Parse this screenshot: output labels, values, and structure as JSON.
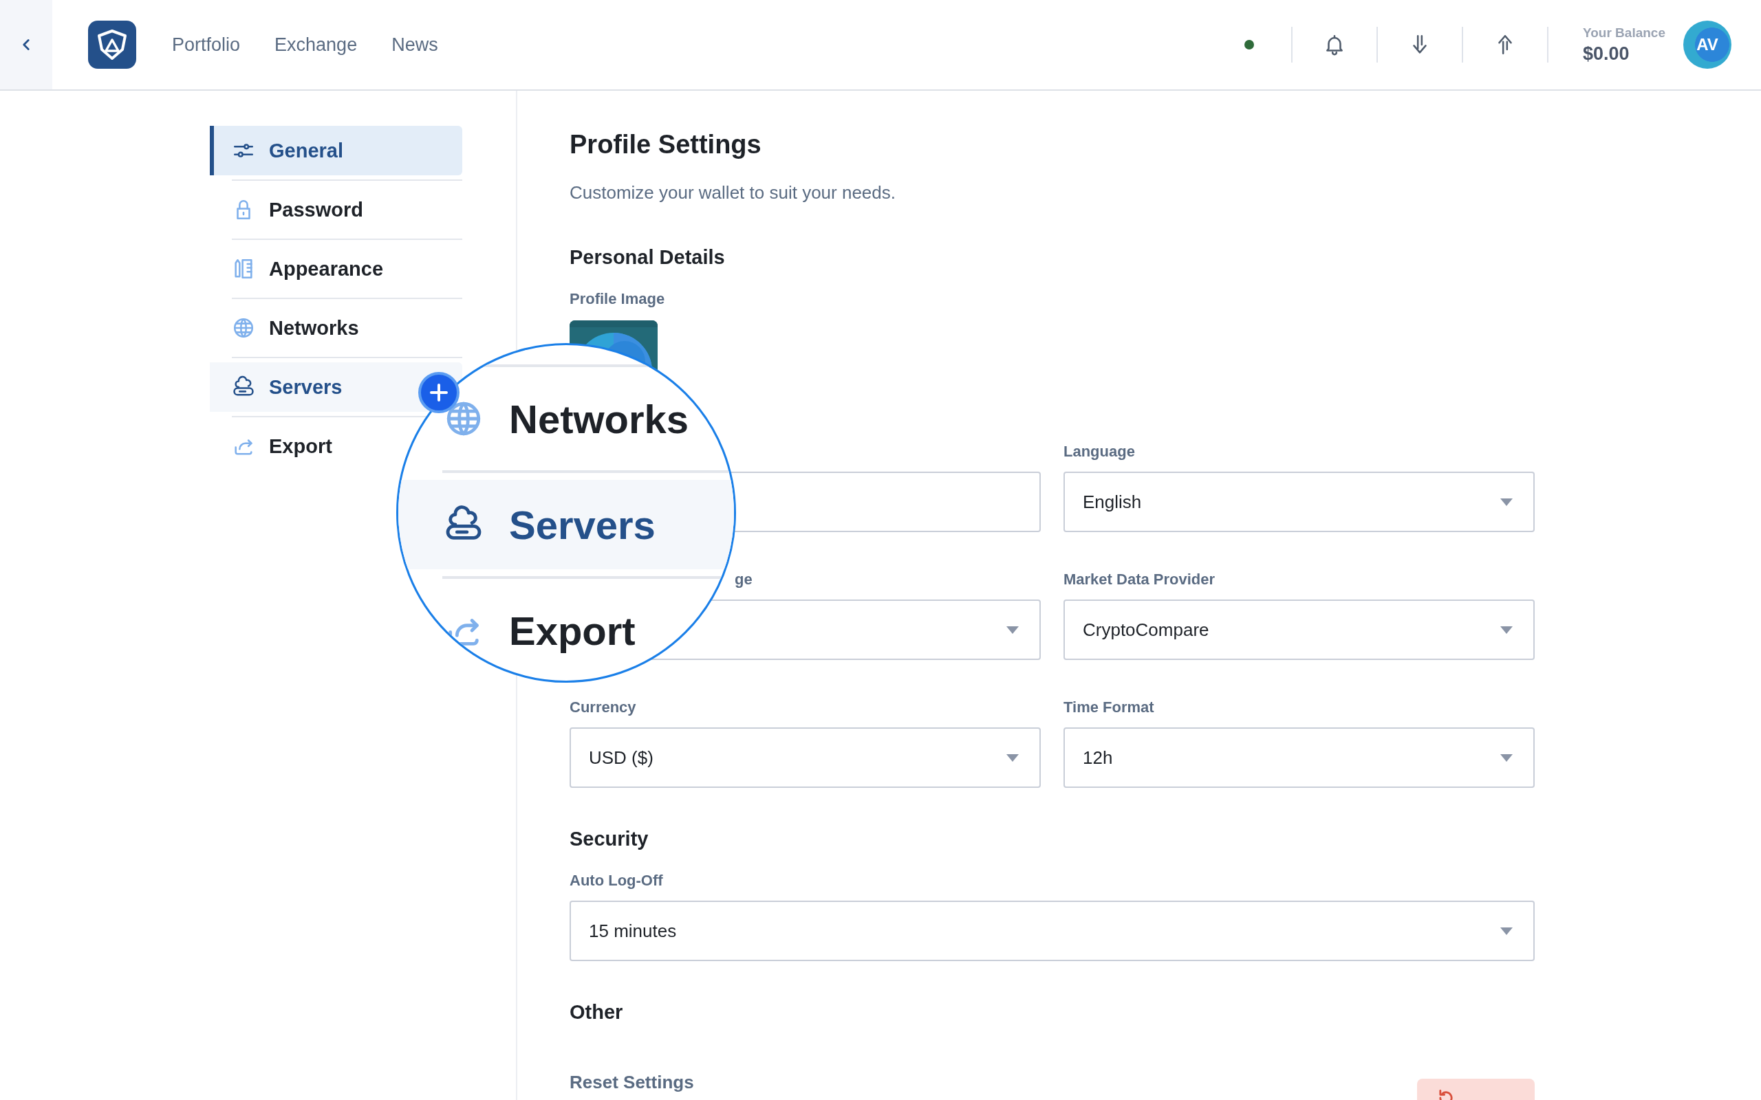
{
  "top_bar": {
    "nav": [
      {
        "label": "Portfolio"
      },
      {
        "label": "Exchange"
      },
      {
        "label": "News"
      }
    ],
    "balance_label": "Your Balance",
    "balance": "$0.00",
    "avatar_initials": "AV"
  },
  "sidebar": {
    "items": [
      {
        "label": "General",
        "selected": true,
        "hovered": false
      },
      {
        "label": "Password",
        "selected": false,
        "hovered": false
      },
      {
        "label": "Appearance",
        "selected": false,
        "hovered": false
      },
      {
        "label": "Networks",
        "selected": false,
        "hovered": false
      },
      {
        "label": "Servers",
        "selected": false,
        "hovered": true
      },
      {
        "label": "Export",
        "selected": false,
        "hovered": false
      }
    ]
  },
  "content": {
    "title": "Profile Settings",
    "subtitle": "Customize your wallet to suit your needs.",
    "personal_details": {
      "heading": "Personal Details",
      "image_label": "Profile Image",
      "fields": [
        {
          "kind": "text"
        },
        {
          "label": "Language",
          "value": "English",
          "kind": "select"
        },
        {
          "label": "ge",
          "label_cut": true,
          "kind": "select"
        },
        {
          "label": "Market Data Provider",
          "value": "CryptoCompare",
          "kind": "select"
        },
        {
          "label": "Currency",
          "value": "USD ($)",
          "kind": "select"
        },
        {
          "label": "Time Format",
          "value": "12h",
          "kind": "select"
        }
      ]
    },
    "security": {
      "heading": "Security",
      "fields": [
        {
          "label": "Auto Log-Off",
          "value": "15 minutes",
          "kind": "select"
        }
      ]
    },
    "other": {
      "heading": "Other",
      "reset_label": "Reset Settings"
    }
  },
  "magnifier": {
    "items": [
      {
        "label": "Networks",
        "highlighted": false
      },
      {
        "label": "Servers",
        "highlighted": true
      },
      {
        "label": "Export",
        "highlighted": false
      }
    ]
  }
}
